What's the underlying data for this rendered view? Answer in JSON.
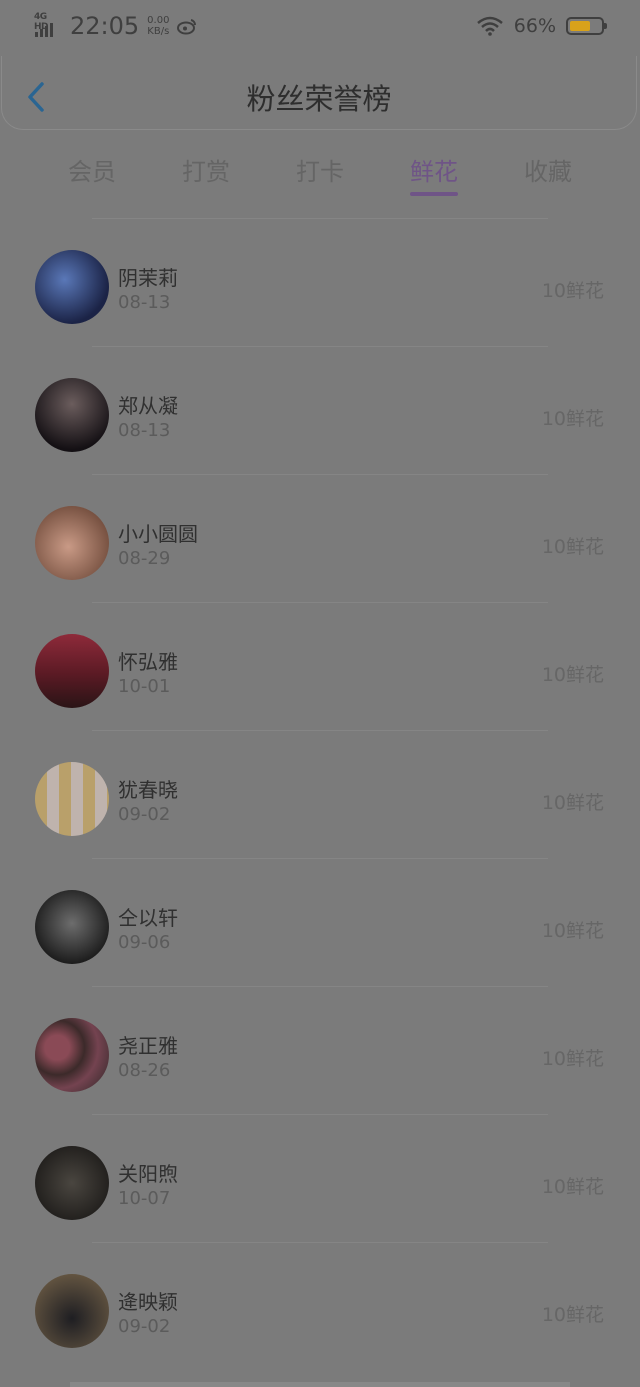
{
  "status_bar": {
    "network": "4G HD",
    "time": "22:05",
    "speed_value": "0.00",
    "speed_unit": "KB/s",
    "battery_pct": "66%",
    "battery_level": 0.66,
    "battery_color": "#d8a21a"
  },
  "header": {
    "title": "粉丝荣誉榜"
  },
  "tabs": [
    {
      "label": "会员",
      "active": false
    },
    {
      "label": "打赏",
      "active": false
    },
    {
      "label": "打卡",
      "active": false
    },
    {
      "label": "鲜花",
      "active": true
    },
    {
      "label": "收藏",
      "active": false
    }
  ],
  "accent_color": "#6f5487",
  "fans": [
    {
      "name": "阴茉莉",
      "date": "08-13",
      "amount": "10鲜花"
    },
    {
      "name": "郑从凝",
      "date": "08-13",
      "amount": "10鲜花"
    },
    {
      "name": "小小圆圆",
      "date": "08-29",
      "amount": "10鲜花"
    },
    {
      "name": "怀弘雅",
      "date": "10-01",
      "amount": "10鲜花"
    },
    {
      "name": "犹春晓",
      "date": "09-02",
      "amount": "10鲜花"
    },
    {
      "name": "仝以轩",
      "date": "09-06",
      "amount": "10鲜花"
    },
    {
      "name": "尧正雅",
      "date": "08-26",
      "amount": "10鲜花"
    },
    {
      "name": "关阳煦",
      "date": "10-07",
      "amount": "10鲜花"
    },
    {
      "name": "逄映颖",
      "date": "09-02",
      "amount": "10鲜花"
    }
  ]
}
